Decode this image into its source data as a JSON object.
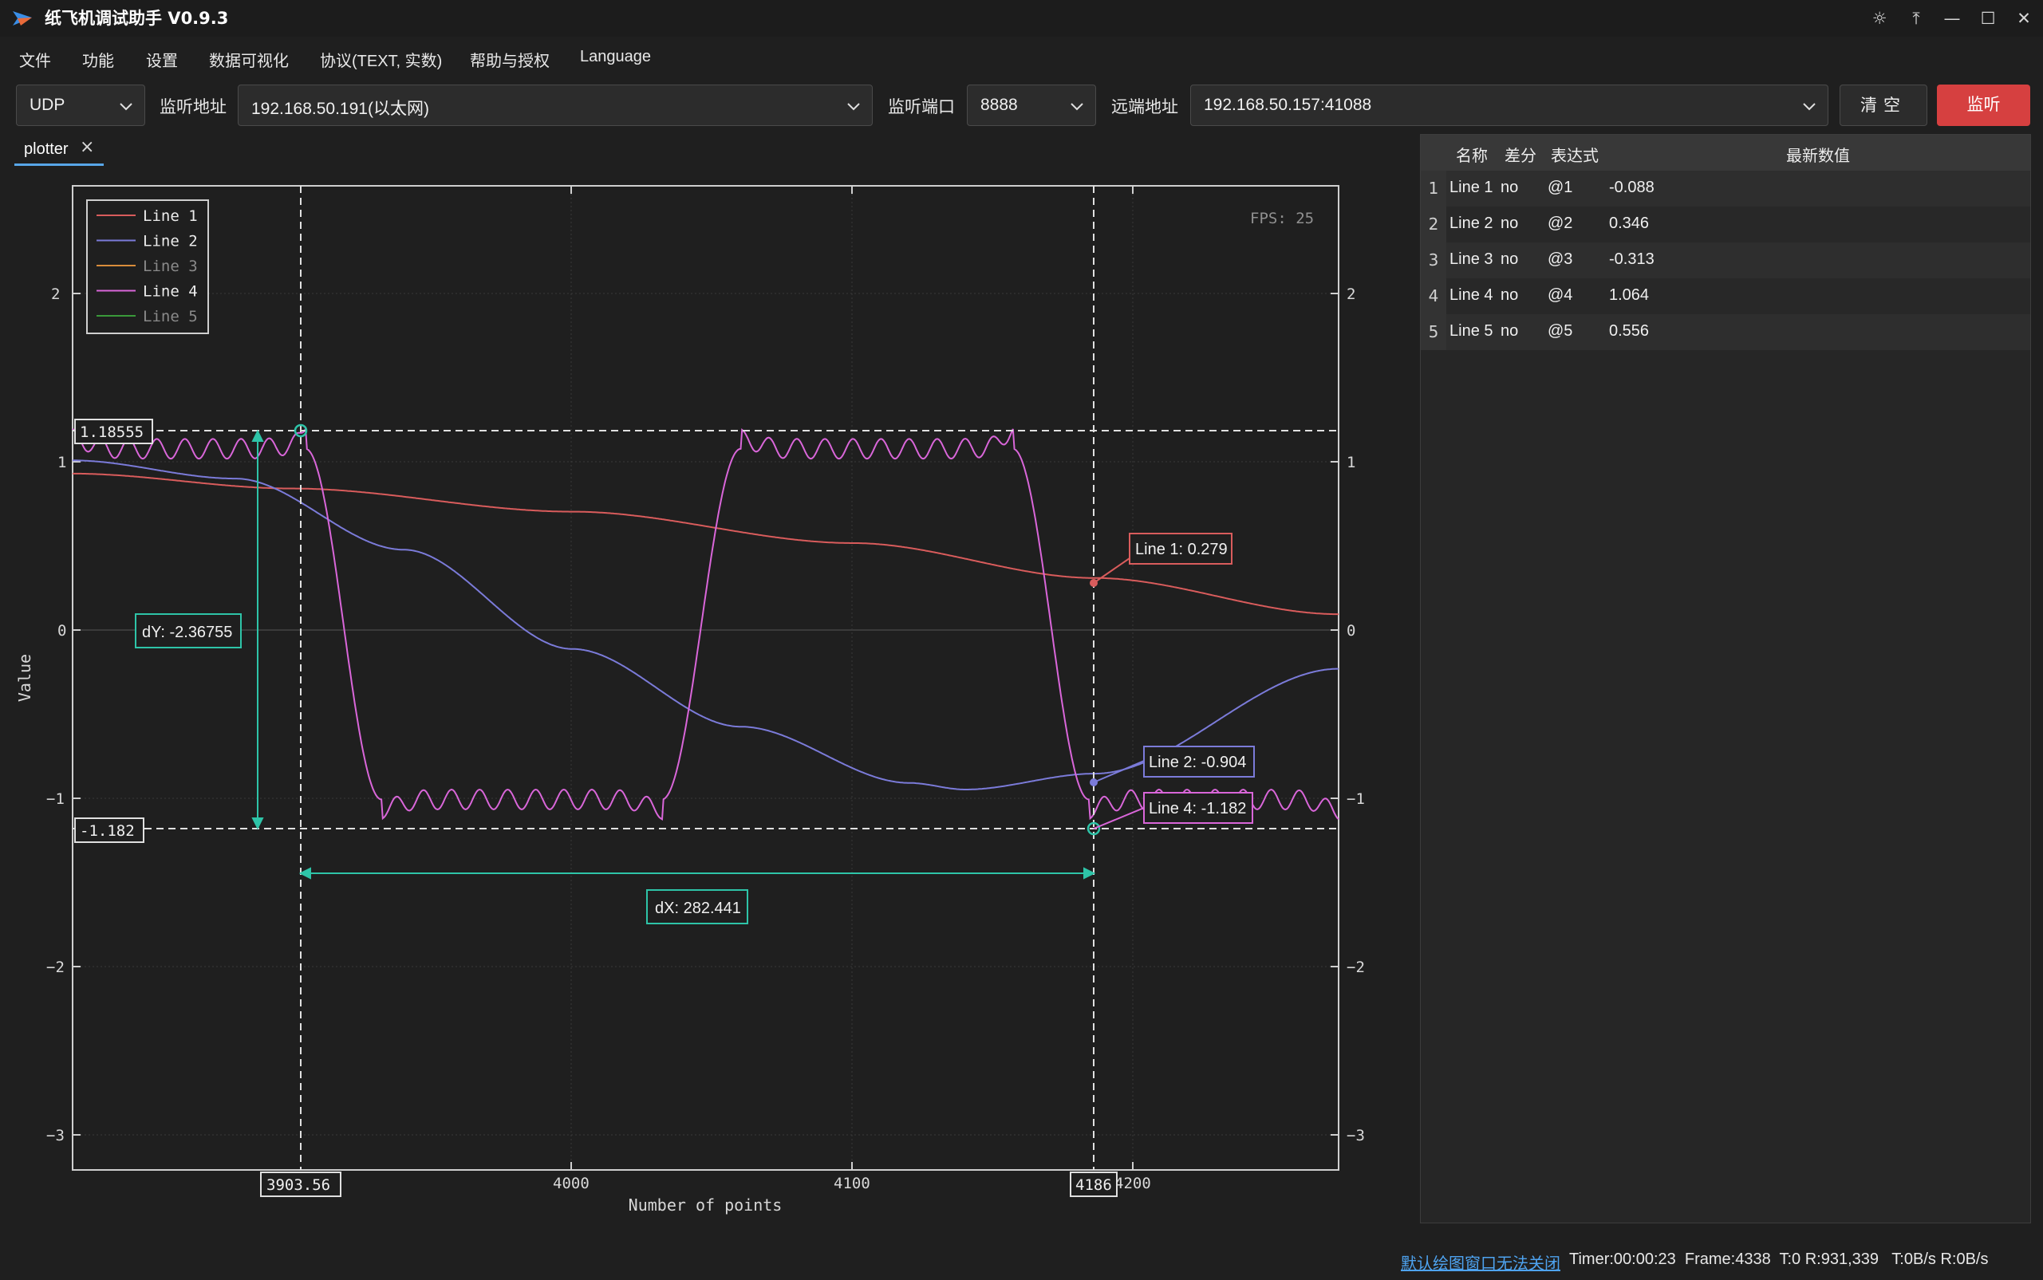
{
  "window": {
    "title": "纸飞机调试助手 V0.9.3"
  },
  "title_buttons": [
    "theme-icon",
    "pin-top-icon",
    "minimize-icon",
    "maximize-icon",
    "close-icon"
  ],
  "menu": [
    "文件",
    "功能",
    "设置",
    "数据可视化",
    "协议(TEXT, 实数)",
    "帮助与授权",
    "Language"
  ],
  "toolbar": {
    "protocol": "UDP",
    "listen_addr_label": "监听地址",
    "listen_addr": "192.168.50.191(以太网)",
    "listen_port_label": "监听端口",
    "listen_port": "8888",
    "remote_addr_label": "远端地址",
    "remote_addr": "192.168.50.157:41088",
    "clear_label": "清空",
    "listen_label": "监听",
    "listen_color": "#d64040"
  },
  "tab": {
    "label": "plotter"
  },
  "plot": {
    "fps": "FPS: 25",
    "ylabel": "Value",
    "xlabel": "Number of points",
    "legend": [
      "Line 1",
      "Line 2",
      "Line 3",
      "Line 4",
      "Line 5"
    ],
    "cursor_x1": "3903.56",
    "cursor_x2": "4186",
    "cursor_y1": "1.18555",
    "cursor_y2": "-1.182",
    "dy": "dY: -2.36755",
    "dx": "dX: 282.441",
    "tip_line1": "Line 1: 0.279",
    "tip_line2": "Line 2: -0.904",
    "tip_line4": "Line 4: -1.182",
    "colors": {
      "line1": "#d95c5c",
      "line2": "#7b7bd9",
      "line3": "#d98c3a",
      "line4": "#d966d9",
      "line5": "#3a9a3a",
      "cursor": "#2ec4a8"
    }
  },
  "chart_data": {
    "type": "line",
    "xlabel": "Number of points",
    "ylabel": "Value",
    "xlim": [
      3822,
      4273
    ],
    "ylim": [
      -3.3,
      2.65
    ],
    "xticks": [
      4000,
      4100,
      4200
    ],
    "yticks": [
      -3,
      -2,
      -1,
      0,
      1,
      2
    ],
    "series": [
      {
        "name": "Line 1",
        "x": [
          3822,
          3900,
          4000,
          4100,
          4186,
          4273
        ],
        "y": [
          0.91,
          0.82,
          0.68,
          0.49,
          0.279,
          0.06
        ]
      },
      {
        "name": "Line 2",
        "x": [
          3822,
          3880,
          3940,
          4000,
          4060,
          4120,
          4140,
          4186,
          4273
        ],
        "y": [
          0.99,
          0.88,
          0.45,
          -0.15,
          -0.62,
          -0.96,
          -1.0,
          -0.904,
          -0.27
        ]
      },
      {
        "name": "Line 4",
        "shape": "square wave with ringing",
        "high": 1.06,
        "low": -1.06,
        "peak": 1.18555,
        "trough": -1.182,
        "x_edges": [
          3907,
          3930,
          4034,
          4058,
          4159,
          4182,
          4273
        ]
      }
    ],
    "latest_values": [
      {
        "name": "Line 1",
        "value": -0.088
      },
      {
        "name": "Line 2",
        "value": 0.346
      },
      {
        "name": "Line 3",
        "value": -0.313
      },
      {
        "name": "Line 4",
        "value": 1.064
      },
      {
        "name": "Line 5",
        "value": 0.556
      }
    ]
  },
  "table": {
    "headers": [
      "名称",
      "差分",
      "表达式",
      "最新数值"
    ],
    "rows": [
      {
        "num": "1",
        "name": "Line 1",
        "diff": "no",
        "expr": "@1",
        "value": "-0.088"
      },
      {
        "num": "2",
        "name": "Line 2",
        "diff": "no",
        "expr": "@2",
        "value": "0.346"
      },
      {
        "num": "3",
        "name": "Line 3",
        "diff": "no",
        "expr": "@3",
        "value": "-0.313"
      },
      {
        "num": "4",
        "name": "Line 4",
        "diff": "no",
        "expr": "@4",
        "value": "1.064"
      },
      {
        "num": "5",
        "name": "Line 5",
        "diff": "no",
        "expr": "@5",
        "value": "0.556"
      }
    ]
  },
  "status": {
    "link": "默认绘图窗口无法关闭",
    "text": "Timer:00:00:23  Frame:4338  T:0 R:931,339   T:0B/s R:0B/s"
  }
}
